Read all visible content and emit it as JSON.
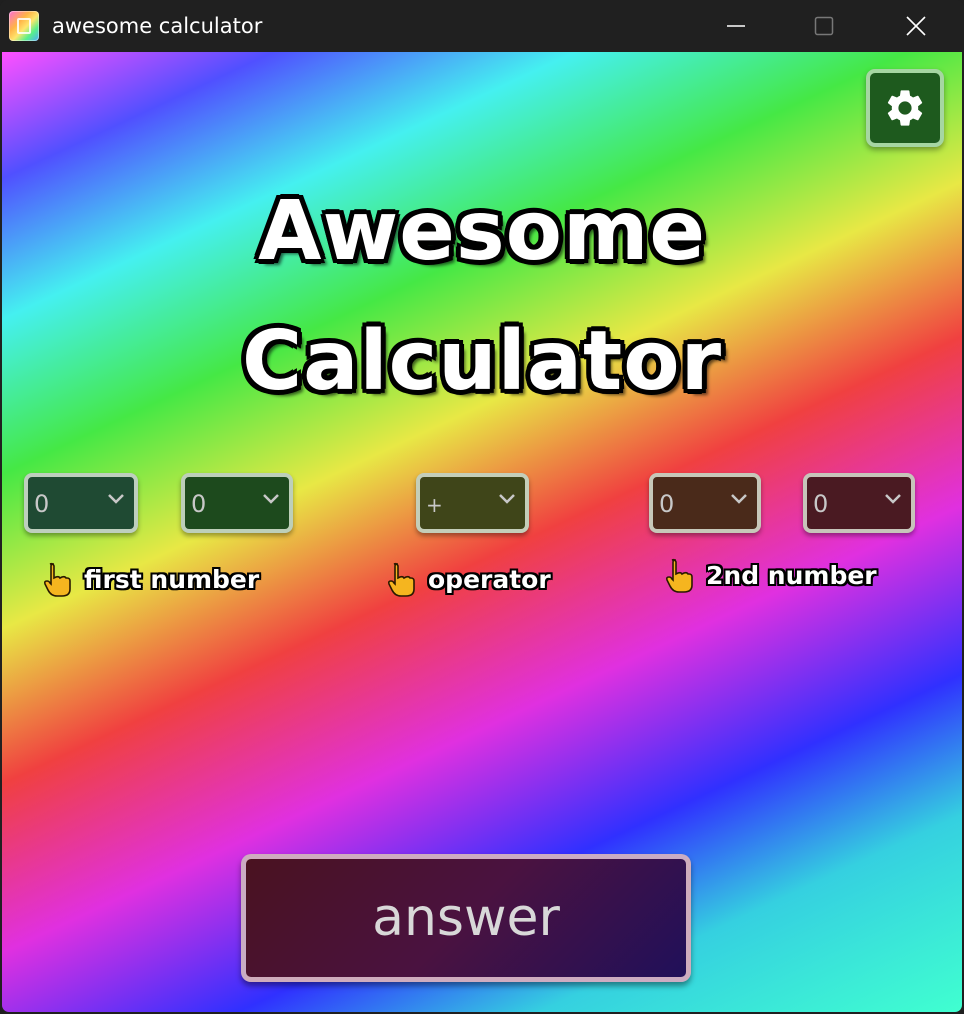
{
  "window": {
    "title": "awesome calculator",
    "icons": {
      "app": "app-icon",
      "minimize": "minimize-icon",
      "maximize": "maximize-icon",
      "close": "close-icon"
    }
  },
  "header": {
    "title_line1": "Awesome",
    "title_line2": "Calculator"
  },
  "settings": {
    "icon": "gear-icon"
  },
  "first_number": {
    "digit1": "0",
    "digit2": "0",
    "label": "first number"
  },
  "operator": {
    "value": "+",
    "label": "operator"
  },
  "second_number": {
    "digit1": "0",
    "digit2": "0",
    "label": "2nd number"
  },
  "answer_button": {
    "label": "answer"
  },
  "colors": {
    "titlebar": "#202020",
    "settings_bg": "#1e5a1e",
    "select_first_1": "#1f4a33",
    "select_first_2": "#1d4a1d",
    "select_operator": "#3f4519",
    "select_second_1": "#4a2a1a",
    "select_second_2": "#4a1a22"
  }
}
